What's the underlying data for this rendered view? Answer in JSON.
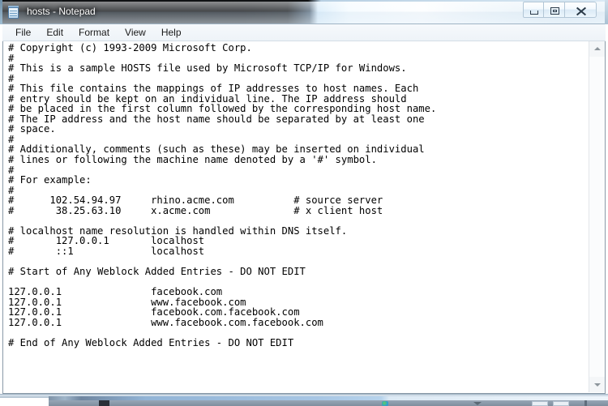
{
  "window": {
    "title": "hosts - Notepad",
    "icon": "notepad-document-icon",
    "controls": {
      "minimize_label": "Minimize",
      "maximize_label": "Maximize",
      "close_label": "Close"
    }
  },
  "menubar": {
    "items": [
      {
        "label": "File"
      },
      {
        "label": "Edit"
      },
      {
        "label": "Format"
      },
      {
        "label": "View"
      },
      {
        "label": "Help"
      }
    ]
  },
  "scrollbar": {
    "up_arrow": "scroll-up-arrow-icon",
    "down_arrow": "scroll-down-arrow-icon",
    "orientation": "vertical"
  },
  "document": {
    "filename": "hosts",
    "content": "# Copyright (c) 1993-2009 Microsoft Corp.\n#\n# This is a sample HOSTS file used by Microsoft TCP/IP for Windows.\n#\n# This file contains the mappings of IP addresses to host names. Each\n# entry should be kept on an individual line. The IP address should\n# be placed in the first column followed by the corresponding host name.\n# The IP address and the host name should be separated by at least one\n# space.\n#\n# Additionally, comments (such as these) may be inserted on individual\n# lines or following the machine name denoted by a '#' symbol.\n#\n# For example:\n#\n#      102.54.94.97     rhino.acme.com          # source server\n#       38.25.63.10     x.acme.com              # x client host\n\n# localhost name resolution is handled within DNS itself.\n#       127.0.0.1       localhost\n#       ::1             localhost\n\n# Start of Any Weblock Added Entries - DO NOT EDIT\n\n127.0.0.1               facebook.com\n127.0.0.1               www.facebook.com\n127.0.0.1               facebook.com.facebook.com\n127.0.0.1               www.facebook.com.facebook.com\n\n# End of Any Weblock Added Entries - DO NOT EDIT"
  },
  "background_window": {
    "description": "partially-visible window behind notepad"
  }
}
